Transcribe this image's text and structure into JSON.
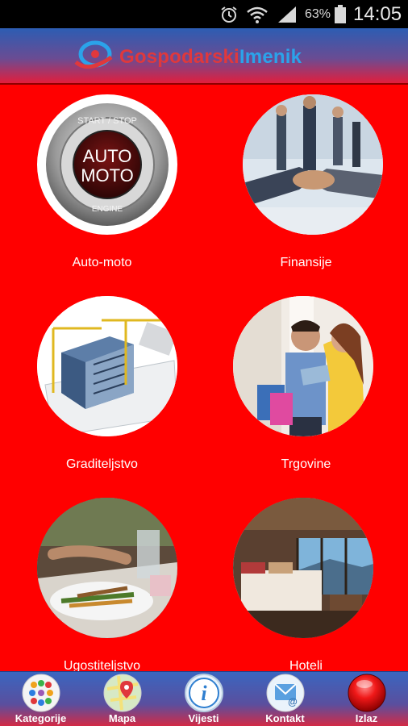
{
  "status_bar": {
    "battery": "63%",
    "time": "14:05"
  },
  "header": {
    "logo_word1": "Gospodarski",
    "logo_word2": "Imenik"
  },
  "categories": [
    {
      "label": "Auto-moto",
      "badge_line1": "AUTO",
      "badge_line2": "MOTO",
      "ring_top": "START / STOP",
      "ring_bottom": "ENGINE"
    },
    {
      "label": "Finansije"
    },
    {
      "label": "Graditeljstvo"
    },
    {
      "label": "Trgovine"
    },
    {
      "label": "Ugostiteljstvo"
    },
    {
      "label": "Hoteli"
    }
  ],
  "nav": [
    {
      "label": "Kategorije",
      "icon": "categories-icon"
    },
    {
      "label": "Mapa",
      "icon": "map-icon"
    },
    {
      "label": "Vijesti",
      "icon": "info-icon"
    },
    {
      "label": "Kontakt",
      "icon": "contact-icon"
    },
    {
      "label": "Izlaz",
      "icon": "exit-icon"
    }
  ],
  "colors": {
    "background": "#ff0000",
    "header_top": "#2c5db3",
    "header_bottom": "#e31e3c"
  }
}
